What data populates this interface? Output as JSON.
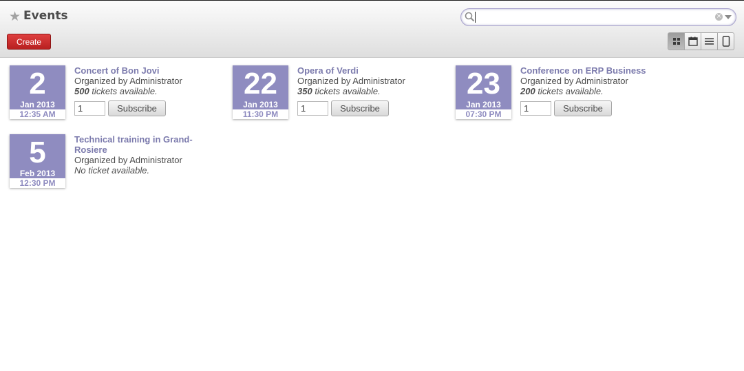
{
  "header": {
    "title": "Events",
    "create_label": "Create",
    "search": {
      "value": "",
      "placeholder": ""
    },
    "view_switcher": [
      "kanban-icon",
      "calendar-icon",
      "list-icon",
      "form-icon"
    ]
  },
  "colors": {
    "accent": "#8f8cc0",
    "link": "#7c7bad",
    "create": "#c8282a"
  },
  "events": [
    {
      "day": "2",
      "month": "Jan 2013",
      "time": "12:35 AM",
      "name": "Concert of Bon Jovi",
      "organizer": "Organized by Administrator",
      "tickets_count": "500",
      "tickets_text": " tickets available.",
      "qty": "1",
      "subscribe": "Subscribe"
    },
    {
      "day": "22",
      "month": "Jan 2013",
      "time": "11:30 PM",
      "name": "Opera of Verdi",
      "organizer": "Organized by Administrator",
      "tickets_count": "350",
      "tickets_text": " tickets available.",
      "qty": "1",
      "subscribe": "Subscribe"
    },
    {
      "day": "23",
      "month": "Jan 2013",
      "time": "07:30 PM",
      "name": "Conference on ERP Business",
      "organizer": "Organized by Administrator",
      "tickets_count": "200",
      "tickets_text": " tickets available.",
      "qty": "1",
      "subscribe": "Subscribe"
    },
    {
      "day": "5",
      "month": "Feb 2013",
      "time": "12:30 PM",
      "name": "Technical training in Grand-Rosiere",
      "organizer": "Organized by Administrator",
      "no_tickets": "No ticket available."
    }
  ]
}
